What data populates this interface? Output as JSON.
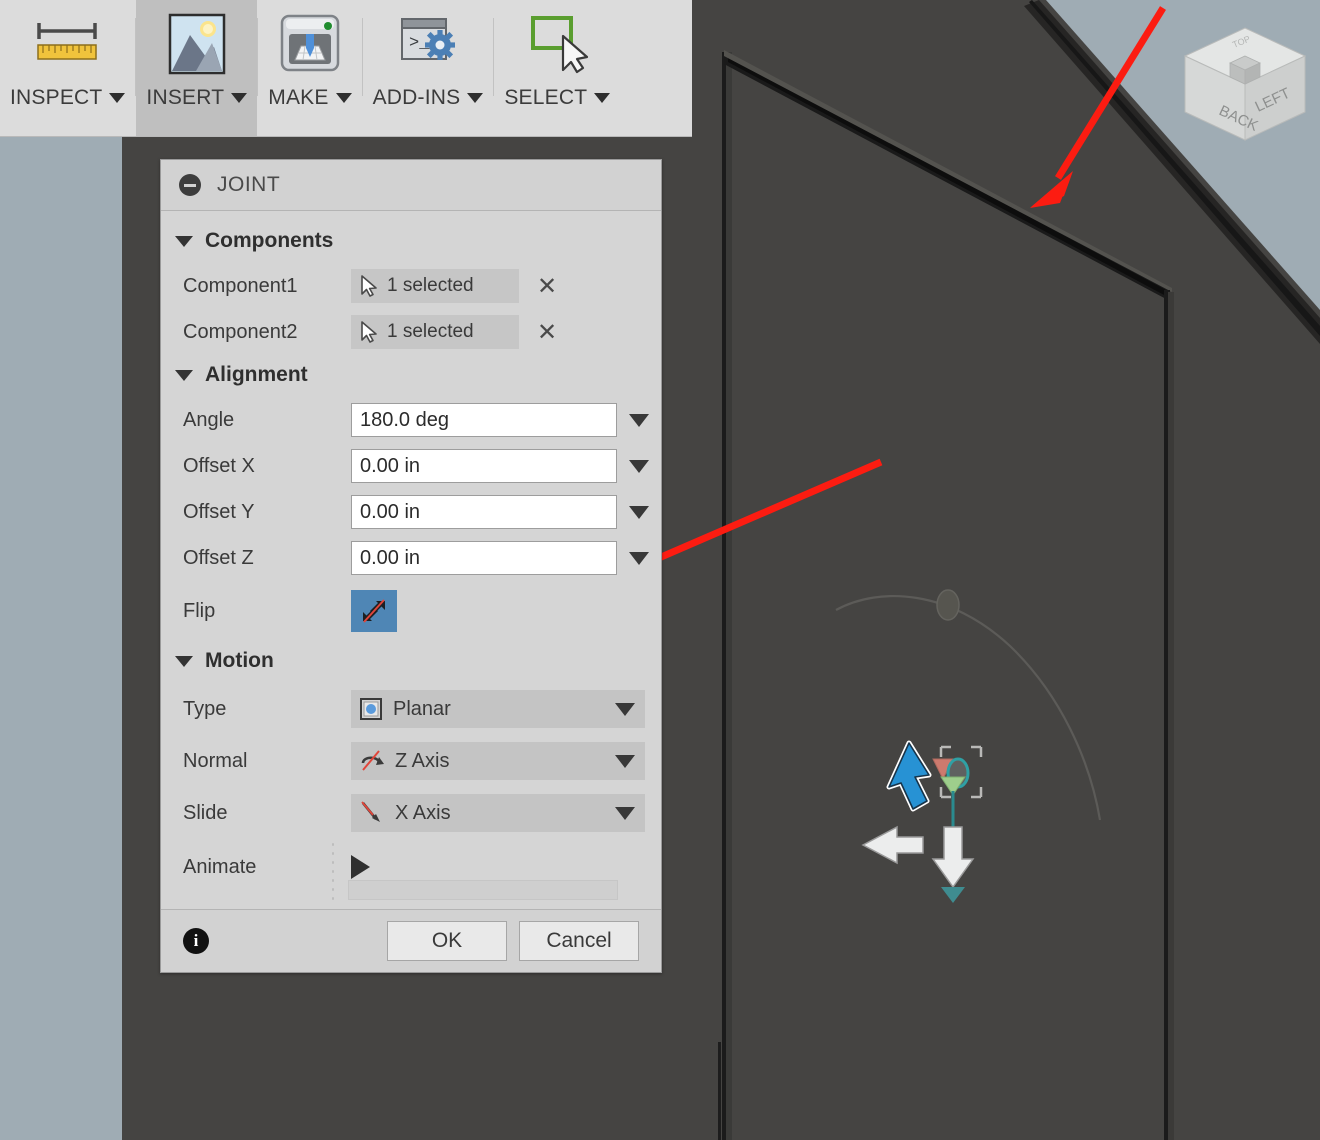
{
  "toolbar": {
    "items": [
      {
        "label": "INSPECT",
        "icon": "ruler-icon",
        "active": false
      },
      {
        "label": "INSERT",
        "icon": "image-insert-icon",
        "active": true
      },
      {
        "label": "MAKE",
        "icon": "3d-printer-icon",
        "active": false
      },
      {
        "label": "ADD-INS",
        "icon": "terminal-gear-icon",
        "active": false
      },
      {
        "label": "SELECT",
        "icon": "selection-cursor-icon",
        "active": false
      }
    ]
  },
  "dialog": {
    "title": "JOINT",
    "collapse_icon": "collapse-minus-icon",
    "sections": {
      "components": {
        "label": "Components",
        "rows": [
          {
            "label": "Component1",
            "value": "1 selected",
            "icon": "cursor-select-icon",
            "clear": "✕"
          },
          {
            "label": "Component2",
            "value": "1 selected",
            "icon": "cursor-select-icon",
            "clear": "✕"
          }
        ]
      },
      "alignment": {
        "label": "Alignment",
        "fields": [
          {
            "label": "Angle",
            "value": "180.0 deg"
          },
          {
            "label": "Offset X",
            "value": "0.00 in"
          },
          {
            "label": "Offset Y",
            "value": "0.00 in"
          },
          {
            "label": "Offset Z",
            "value": "0.00 in"
          }
        ],
        "flip": {
          "label": "Flip",
          "icon": "flip-arrows-icon",
          "active": true,
          "color": "#4f86b5"
        }
      },
      "motion": {
        "label": "Motion",
        "fields": [
          {
            "label": "Type",
            "value": "Planar",
            "icon": "planar-motion-icon"
          },
          {
            "label": "Normal",
            "value": "Z Axis",
            "icon": "rotation-axis-icon"
          },
          {
            "label": "Slide",
            "value": "X Axis",
            "icon": "slide-axis-icon"
          }
        ],
        "animate": {
          "label": "Animate",
          "icon": "play-icon"
        }
      }
    },
    "footer": {
      "info_icon": "info-icon",
      "ok_label": "OK",
      "cancel_label": "Cancel"
    }
  },
  "viewcube": {
    "face_left_label": "BACK",
    "face_right_label": "LEFT",
    "top_label": "TOP"
  },
  "annotations": [
    {
      "name": "arrow-to-panel-edge",
      "color": "#fc1c11"
    },
    {
      "name": "arrow-to-flip-button",
      "color": "#fc1c11"
    }
  ],
  "colors": {
    "viewport_background": "#9facb4",
    "model_face": "#454442",
    "dialog_background": "#d5d5d5",
    "toolbar_background": "#dcdcdc",
    "accent_blue": "#4f86b5",
    "annotation_red": "#fc1c11",
    "select_green": "#5a9e2f"
  }
}
